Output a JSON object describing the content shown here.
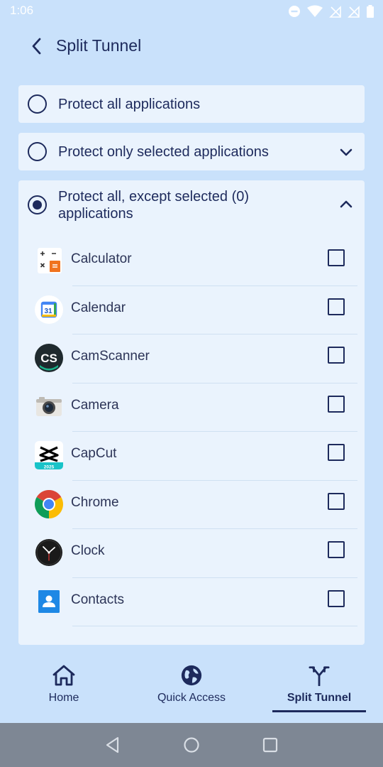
{
  "status_bar": {
    "time": "1:06",
    "icons": [
      "dnd-icon",
      "wifi-icon",
      "signal-icon",
      "signal-icon",
      "battery-icon"
    ]
  },
  "header": {
    "back_icon": "chevron-left-icon",
    "title": "Split Tunnel"
  },
  "options": [
    {
      "label": "Protect all applications",
      "selected": false
    },
    {
      "label": "Protect only selected applications",
      "selected": false,
      "expanded": false
    },
    {
      "label": "Protect all, except selected (0) applications",
      "selected": true,
      "expanded": true
    }
  ],
  "apps": [
    {
      "name": "Calculator",
      "icon": "calculator-icon",
      "checked": false
    },
    {
      "name": "Calendar",
      "icon": "calendar-icon",
      "checked": false
    },
    {
      "name": "CamScanner",
      "icon": "camscanner-icon",
      "checked": false
    },
    {
      "name": "Camera",
      "icon": "camera-icon",
      "checked": false
    },
    {
      "name": "CapCut",
      "icon": "capcut-icon",
      "checked": false
    },
    {
      "name": "Chrome",
      "icon": "chrome-icon",
      "checked": false
    },
    {
      "name": "Clock",
      "icon": "clock-icon",
      "checked": false
    },
    {
      "name": "Contacts",
      "icon": "contacts-icon",
      "checked": false
    }
  ],
  "icon_text": {
    "calendar_day": "31",
    "camscanner": "CS",
    "capcut_year": "2025"
  },
  "bottom_nav": [
    {
      "label": "Home",
      "icon": "home-icon",
      "active": false
    },
    {
      "label": "Quick Access",
      "icon": "globe-icon",
      "active": false
    },
    {
      "label": "Split Tunnel",
      "icon": "split-arrows-icon",
      "active": true
    }
  ],
  "system_nav": [
    "back-triangle-icon",
    "home-circle-icon",
    "recents-square-icon"
  ],
  "colors": {
    "background": "#c9e1fb",
    "card": "#eaf3fd",
    "primary": "#1d2a5c",
    "system_nav": "#7e8794"
  }
}
